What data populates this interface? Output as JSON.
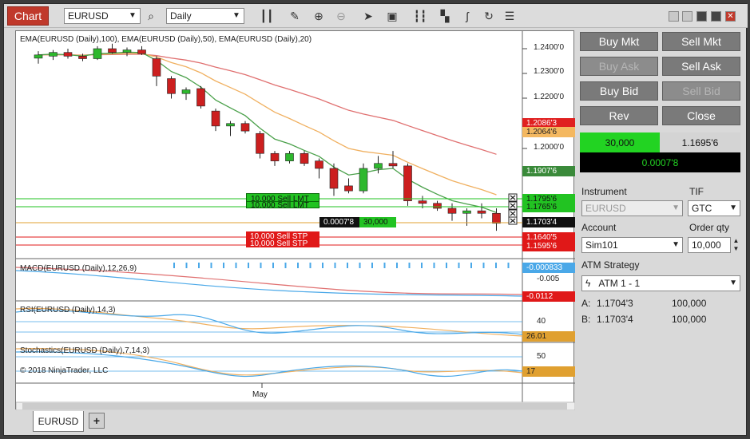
{
  "toolbar": {
    "chart_tab": "Chart",
    "instrument": "EURUSD",
    "period": "Daily",
    "icons": [
      "search-icon",
      "bar-style-icon",
      "draw-pencil-icon",
      "zoom-in-icon",
      "zoom-out-icon",
      "pointer-icon",
      "data-box-icon",
      "order-book-icon",
      "strategy-icon",
      "indicator-icon",
      "refresh-icon",
      "list-icon"
    ]
  },
  "chart": {
    "price_panel_title": "EMA(EURUSD (Daily),100), EMA(EURUSD (Daily),50), EMA(EURUSD (Daily),20)",
    "price_ticks": [
      "1.2400'0",
      "1.2300'0",
      "1.2200'0",
      "1.2000'0"
    ],
    "price_tags": {
      "ema100": "1.2086'3",
      "ema50": "1.2064'6",
      "ema20": "1.1907'6",
      "sell_lmt1": "1.1795'6",
      "sell_lmt2": "1.1765'6",
      "last": "1.1703'4",
      "sell_stp1": "1.1640'5",
      "sell_stp2": "1.1595'6"
    },
    "orders": {
      "sell_lmt": "10,000  Sell LMT",
      "sell_lmt2": "10,000  Sell LMT",
      "sell_stp": "10,000  Sell STP",
      "sell_stp2": "10,000  Sell STP",
      "pnl": "0.0007'8",
      "position_qty": "30,000"
    },
    "macd_title": "MACD(EURUSD (Daily),12,26,9)",
    "macd_tick": "-0.005",
    "macd_tags": {
      "macd": "-0.000833",
      "avg": "-0.0112"
    },
    "rsi_title": "RSI(EURUSD (Daily),14,3)",
    "rsi_tick": "40",
    "rsi_tag": "26.01",
    "stoch_title": "Stochastics(EURUSD (Daily),7,14,3)",
    "stoch_tick": "50",
    "stoch_tag": "17",
    "copyright": "© 2018 NinjaTrader, LLC",
    "x_label": "May",
    "candles": [
      [
        1.2362,
        1.239,
        1.234,
        1.2375
      ],
      [
        1.237,
        1.2395,
        1.2355,
        1.2385
      ],
      [
        1.2385,
        1.24,
        1.236,
        1.237
      ],
      [
        1.237,
        1.238,
        1.235,
        1.236
      ],
      [
        1.236,
        1.241,
        1.2355,
        1.24
      ],
      [
        1.24,
        1.242,
        1.238,
        1.2385
      ],
      [
        1.2385,
        1.2405,
        1.237,
        1.2395
      ],
      [
        1.2395,
        1.241,
        1.2375,
        1.238
      ],
      [
        1.236,
        1.237,
        1.225,
        1.229
      ],
      [
        1.228,
        1.229,
        1.22,
        1.222
      ],
      [
        1.222,
        1.2245,
        1.2195,
        1.2235
      ],
      [
        1.224,
        1.225,
        1.216,
        1.217
      ],
      [
        1.215,
        1.216,
        1.207,
        1.209
      ],
      [
        1.209,
        1.211,
        1.205,
        1.21
      ],
      [
        1.21,
        1.211,
        1.206,
        1.207
      ],
      [
        1.206,
        1.207,
        1.196,
        1.198
      ],
      [
        1.198,
        1.199,
        1.193,
        1.195
      ],
      [
        1.195,
        1.199,
        1.194,
        1.198
      ],
      [
        1.198,
        1.199,
        1.193,
        1.194
      ],
      [
        1.195,
        1.196,
        1.188,
        1.192
      ],
      [
        1.192,
        1.194,
        1.181,
        1.184
      ],
      [
        1.185,
        1.188,
        1.182,
        1.183
      ],
      [
        1.183,
        1.194,
        1.182,
        1.192
      ],
      [
        1.192,
        1.197,
        1.19,
        1.194
      ],
      [
        1.194,
        1.199,
        1.192,
        1.193
      ],
      [
        1.193,
        1.194,
        1.177,
        1.179
      ],
      [
        1.179,
        1.181,
        1.176,
        1.178
      ],
      [
        1.178,
        1.179,
        1.175,
        1.176
      ],
      [
        1.176,
        1.178,
        1.171,
        1.174
      ],
      [
        1.174,
        1.176,
        1.169,
        1.175
      ],
      [
        1.175,
        1.178,
        1.172,
        1.174
      ],
      [
        1.174,
        1.176,
        1.167,
        1.17
      ]
    ]
  },
  "panel": {
    "buy_mkt": "Buy Mkt",
    "sell_mkt": "Sell Mkt",
    "buy_ask": "Buy Ask",
    "sell_ask": "Sell Ask",
    "buy_bid": "Buy Bid",
    "sell_bid": "Sell Bid",
    "rev": "Rev",
    "close": "Close",
    "position_qty": "30,000",
    "position_price": "1.1695'6",
    "position_pnl": "0.0007'8",
    "instrument_label": "Instrument",
    "tif_label": "TIF",
    "instrument_value": "EURUSD",
    "tif_value": "GTC",
    "account_label": "Account",
    "order_qty_label": "Order qty",
    "account_value": "Sim101",
    "order_qty_value": "10,000",
    "atm_label": "ATM Strategy",
    "atm_value": "ATM 1 - 1",
    "ask_label": "A:",
    "ask_price": "1.1704'3",
    "ask_size": "100,000",
    "bid_label": "B:",
    "bid_price": "1.1703'4",
    "bid_size": "100,000"
  },
  "tabs": {
    "active": "EURUSD",
    "add": "+"
  },
  "colors": {
    "up": "#2db82d",
    "down": "#cc1f1f",
    "ema100": "#e07070",
    "ema50": "#4aa04a",
    "ema20": "#f0b060",
    "accent": "#c0392b"
  }
}
